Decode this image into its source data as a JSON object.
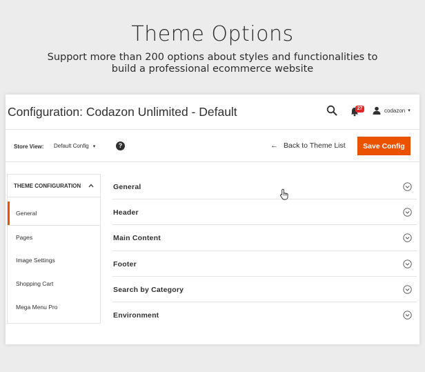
{
  "hero": {
    "title": "Theme Options",
    "subtitle_line1": "Support more than 200 options about styles and functionalities to",
    "subtitle_line2": "build a professional ecommerce website"
  },
  "header": {
    "title": "Configuration: Codazon Unlimited - Default",
    "search_icon": "search-icon",
    "notifications_icon": "bell-icon",
    "notifications_count": "27",
    "user_icon": "user-icon",
    "username": "codazon"
  },
  "scope": {
    "store_view_label": "Store View:",
    "store_view_value": "Default Config",
    "help_icon": "question-circle-icon",
    "back_label": "Back to Theme List",
    "save_label": "Save Config"
  },
  "sidebar": {
    "heading": "THEME CONFIGURATION",
    "items": [
      {
        "label": "General",
        "active": true
      },
      {
        "label": "Pages",
        "active": false
      },
      {
        "label": "Image Settings",
        "active": false
      },
      {
        "label": "Shopping Cart",
        "active": false
      },
      {
        "label": "Mega Menu Pro",
        "active": false
      }
    ]
  },
  "sections": [
    {
      "label": "General"
    },
    {
      "label": "Header"
    },
    {
      "label": "Main Content"
    },
    {
      "label": "Footer"
    },
    {
      "label": "Search by Category"
    },
    {
      "label": "Environment"
    }
  ],
  "colors": {
    "accent": "#eb5202",
    "badge": "#e22626",
    "text": "#303030",
    "border": "#e3e3e3",
    "background": "#ececec"
  }
}
